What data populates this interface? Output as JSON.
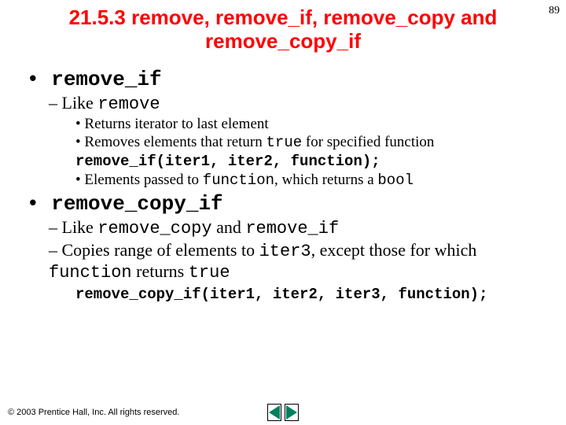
{
  "page_number": "89",
  "title": "21.5.3 remove, remove_if, remove_copy and remove_copy_if",
  "sections": [
    {
      "heading_mono": "remove_if",
      "sub": [
        {
          "text_pre": "Like ",
          "text_mono": "remove",
          "details": [
            {
              "kind": "bullet",
              "text": "Returns iterator to last element"
            },
            {
              "kind": "bullet_mixed",
              "t1": "Removes elements that return ",
              "m1": "true",
              "t2": " for specified function"
            },
            {
              "kind": "code",
              "text": "remove_if(iter1, iter2, function);"
            },
            {
              "kind": "bullet_mixed2",
              "t1": "Elements passed to ",
              "m1": "function",
              "t2": ", which returns a ",
              "m2": "bool"
            }
          ]
        }
      ]
    },
    {
      "heading_mono": "remove_copy_if",
      "sub": [
        {
          "text_pre": "Like ",
          "text_mono": "remove_copy",
          "text_mid": " and ",
          "text_mono2": "remove_if"
        },
        {
          "mixed": true,
          "t1": "Copies range of elements to ",
          "m1": "iter3",
          "t2": ", except those for which ",
          "m2": "function",
          "t3": " returns ",
          "m3": "true"
        }
      ],
      "code": "remove_copy_if(iter1, iter2, iter3, function);"
    }
  ],
  "footer": {
    "copyright": "© 2003 Prentice Hall, Inc. All rights reserved."
  }
}
